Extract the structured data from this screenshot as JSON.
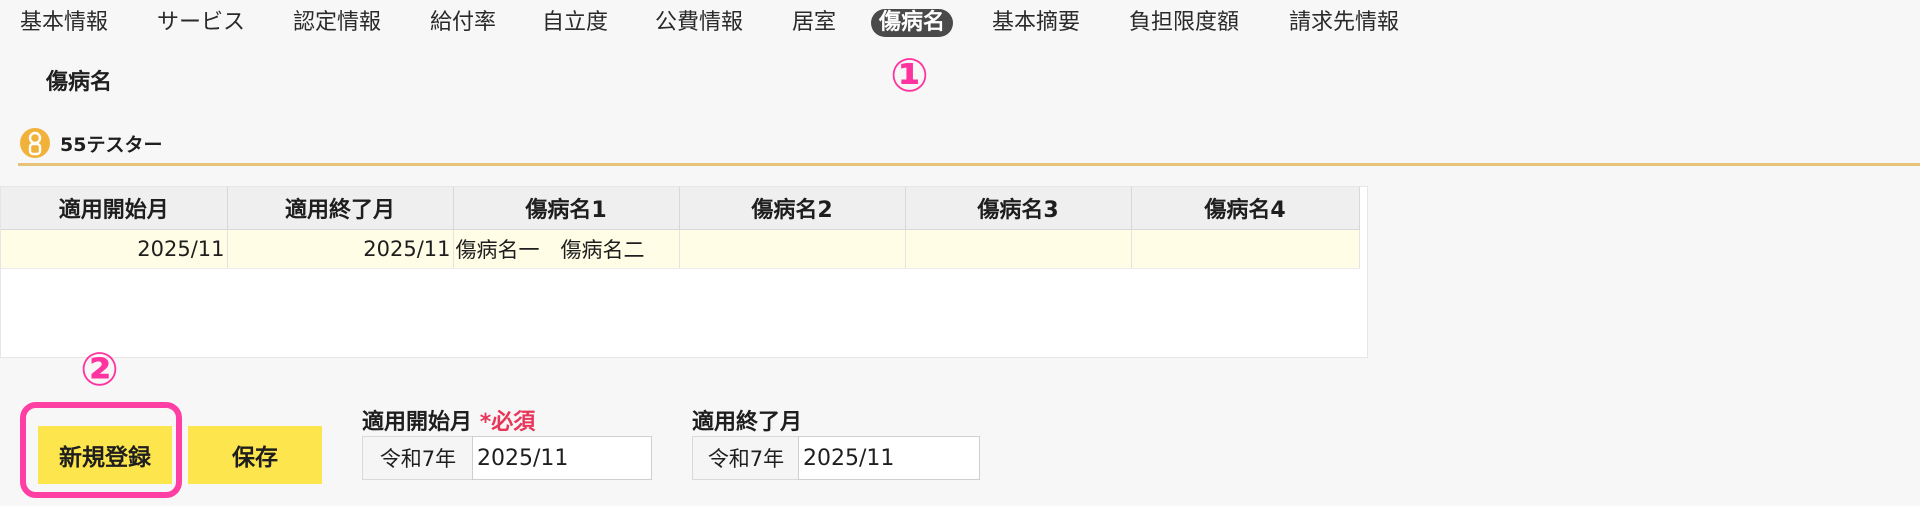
{
  "tabs": [
    {
      "label": "基本情報"
    },
    {
      "label": "サービス"
    },
    {
      "label": "認定情報"
    },
    {
      "label": "給付率"
    },
    {
      "label": "自立度"
    },
    {
      "label": "公費情報"
    },
    {
      "label": "居室"
    },
    {
      "label": "傷病名",
      "active": true
    },
    {
      "label": "基本摘要"
    },
    {
      "label": "負担限度額"
    },
    {
      "label": "請求先情報"
    }
  ],
  "annotations": {
    "step1": "①",
    "step2": "②",
    "highlight_color": "#ff3fa3"
  },
  "section_title": "傷病名",
  "user": {
    "name": "55テスター",
    "icon": "person-icon"
  },
  "table": {
    "headers": [
      "適用開始月",
      "適用終了月",
      "傷病名1",
      "傷病名2",
      "傷病名3",
      "傷病名4"
    ],
    "rows": [
      [
        "2025/11",
        "2025/11",
        "傷病名一　傷病名二",
        "",
        "",
        ""
      ]
    ]
  },
  "buttons": {
    "new": "新規登録",
    "save": "保存"
  },
  "form": {
    "start": {
      "label": "適用開始月",
      "required": "*必須",
      "era": "令和7年",
      "value": "2025/11"
    },
    "end": {
      "label": "適用終了月",
      "era": "令和7年",
      "value": "2025/11"
    }
  },
  "colors": {
    "accent_yellow": "#fde54e",
    "active_tab": "#4a4a4a",
    "divider": "#e7c37a",
    "required": "#e8365b"
  }
}
